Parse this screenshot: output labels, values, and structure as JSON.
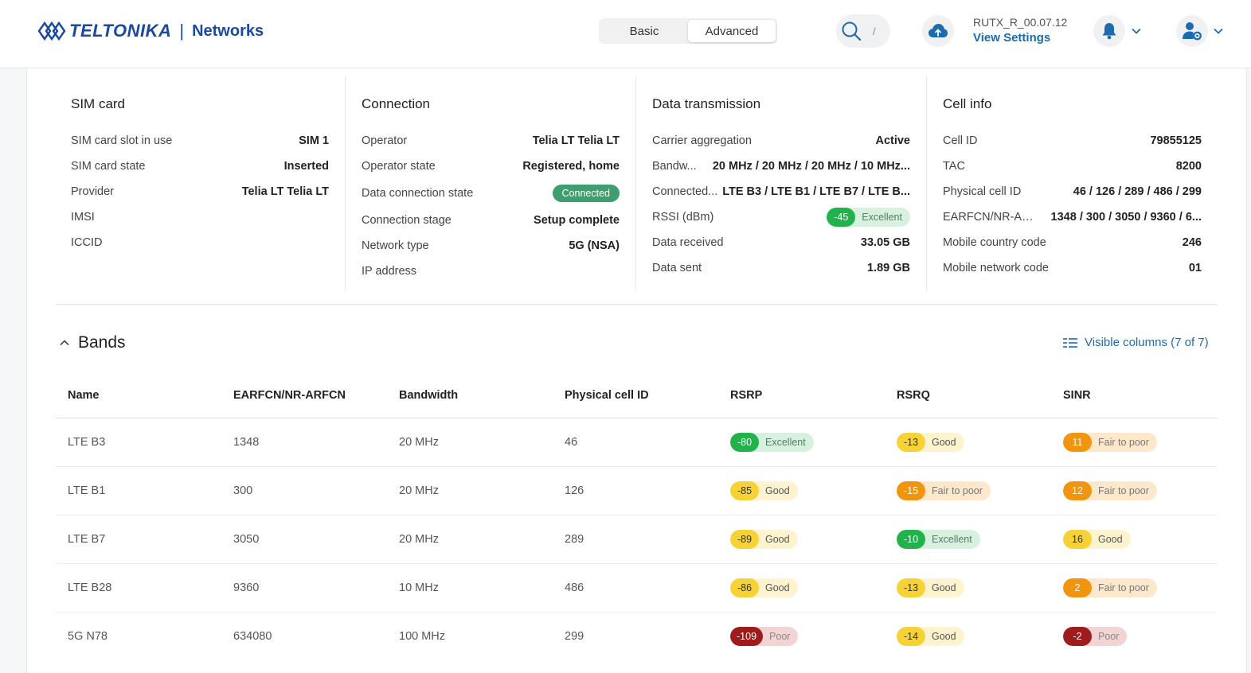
{
  "header": {
    "logo_text": "TELTONIKA",
    "logo_sub": "Networks",
    "logo_sep": "|",
    "modes": [
      "Basic",
      "Advanced"
    ],
    "active_mode": "Advanced",
    "search_shortcut": "/",
    "firmware_version": "RUTX_R_00.07.12",
    "view_settings": "View Settings"
  },
  "sim_card": {
    "title": "SIM card",
    "rows": [
      {
        "label": "SIM card slot in use",
        "value": "SIM 1"
      },
      {
        "label": "SIM card state",
        "value": "Inserted"
      },
      {
        "label": "Provider",
        "value": "Telia LT Telia LT"
      },
      {
        "label": "IMSI",
        "value": ""
      },
      {
        "label": "ICCID",
        "value": ""
      }
    ]
  },
  "connection": {
    "title": "Connection",
    "rows": [
      {
        "label": "Operator",
        "value": "Telia LT Telia LT"
      },
      {
        "label": "Operator state",
        "value": "Registered, home"
      },
      {
        "label": "Data connection state",
        "value": "Connected"
      },
      {
        "label": "Connection stage",
        "value": "Setup complete"
      },
      {
        "label": "Network type",
        "value": "5G (NSA)"
      },
      {
        "label": "IP address",
        "value": ""
      }
    ]
  },
  "data_transmission": {
    "title": "Data transmission",
    "rows": [
      {
        "label": "Carrier aggregation",
        "value": "Active"
      },
      {
        "label": "Bandw...",
        "value": "20 MHz / 20 MHz / 20 MHz / 10 MHz..."
      },
      {
        "label": "Connected...",
        "value": "LTE B3 / LTE B1 / LTE B7 / LTE B..."
      },
      {
        "label": "RSSI (dBm)",
        "value": "-45",
        "quality": "Excellent"
      },
      {
        "label": "Data received",
        "value": "33.05 GB"
      },
      {
        "label": "Data sent",
        "value": "1.89 GB"
      }
    ]
  },
  "cell_info": {
    "title": "Cell info",
    "rows": [
      {
        "label": "Cell ID",
        "value": "79855125"
      },
      {
        "label": "TAC",
        "value": "8200"
      },
      {
        "label": "Physical cell ID",
        "value": "46 / 126 / 289 / 486 / 299"
      },
      {
        "label": "EARFCN/NR-AR...",
        "value": "1348 / 300 / 3050 / 9360 / 6..."
      },
      {
        "label": "Mobile country code",
        "value": "246"
      },
      {
        "label": "Mobile network code",
        "value": "01"
      }
    ]
  },
  "bands": {
    "title": "Bands",
    "visible_columns": "Visible columns (7 of 7)",
    "columns": [
      "Name",
      "EARFCN/NR-ARFCN",
      "Bandwidth",
      "Physical cell ID",
      "RSRP",
      "RSRQ",
      "SINR"
    ],
    "rows": [
      {
        "name": "LTE B3",
        "earfcn": "1348",
        "bandwidth": "20 MHz",
        "pci": "46",
        "rsrp": {
          "v": "-80",
          "q": "Excellent",
          "c": "green"
        },
        "rsrq": {
          "v": "-13",
          "q": "Good",
          "c": "yellow"
        },
        "sinr": {
          "v": "11",
          "q": "Fair to poor",
          "c": "orange"
        }
      },
      {
        "name": "LTE B1",
        "earfcn": "300",
        "bandwidth": "20 MHz",
        "pci": "126",
        "rsrp": {
          "v": "-85",
          "q": "Good",
          "c": "yellow"
        },
        "rsrq": {
          "v": "-15",
          "q": "Fair to poor",
          "c": "orange"
        },
        "sinr": {
          "v": "12",
          "q": "Fair to poor",
          "c": "orange"
        }
      },
      {
        "name": "LTE B7",
        "earfcn": "3050",
        "bandwidth": "20 MHz",
        "pci": "289",
        "rsrp": {
          "v": "-89",
          "q": "Good",
          "c": "yellow"
        },
        "rsrq": {
          "v": "-10",
          "q": "Excellent",
          "c": "green"
        },
        "sinr": {
          "v": "16",
          "q": "Good",
          "c": "yellow"
        }
      },
      {
        "name": "LTE B28",
        "earfcn": "9360",
        "bandwidth": "10 MHz",
        "pci": "486",
        "rsrp": {
          "v": "-86",
          "q": "Good",
          "c": "yellow"
        },
        "rsrq": {
          "v": "-13",
          "q": "Good",
          "c": "yellow"
        },
        "sinr": {
          "v": "2",
          "q": "Fair to poor",
          "c": "orange"
        }
      },
      {
        "name": "5G N78",
        "earfcn": "634080",
        "bandwidth": "100 MHz",
        "pci": "299",
        "rsrp": {
          "v": "-109",
          "q": "Poor",
          "c": "red"
        },
        "rsrq": {
          "v": "-14",
          "q": "Good",
          "c": "yellow"
        },
        "sinr": {
          "v": "-2",
          "q": "Poor",
          "c": "red"
        }
      }
    ]
  },
  "colors": {
    "brand": "#1a4a9e",
    "link": "#1a6bb0",
    "connected": "#3f9e6d",
    "excellent": "#22b24c",
    "good": "#f7d237",
    "fair": "#f1940e",
    "poor": "#9e1c1c"
  }
}
